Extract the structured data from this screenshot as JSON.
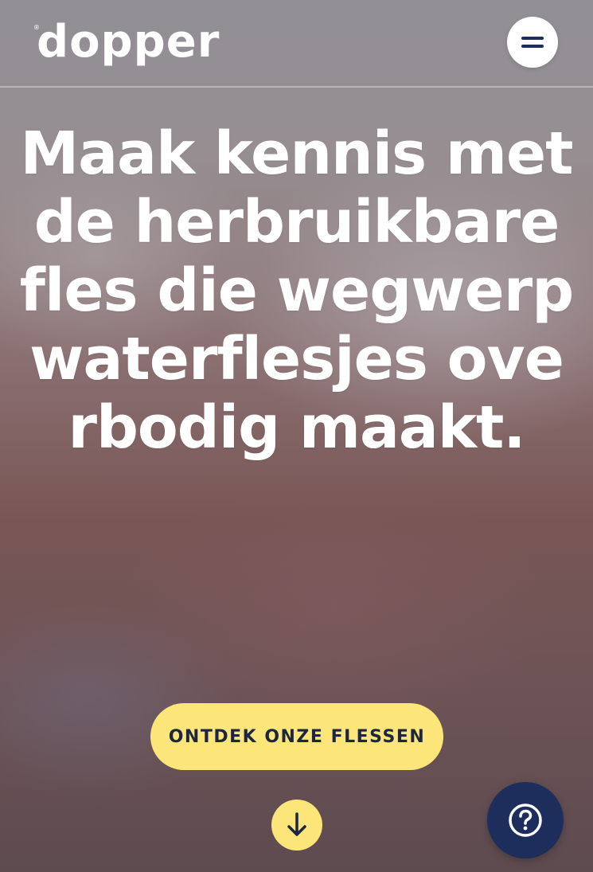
{
  "header": {
    "logo_text": "dopper",
    "logo_registered": "®",
    "menu_icon": "hamburger-menu-icon"
  },
  "hero": {
    "title": "Maak kennis met de herbruikbare fles die wegwerpwaterflesjes overbodig maakt.",
    "cta_label": "ONTDEK ONZE FLESSEN",
    "scroll_icon": "arrow-down-icon"
  },
  "help": {
    "icon": "question-mark-icon"
  },
  "colors": {
    "accent_yellow": "#fce67a",
    "navy": "#1d2e5c",
    "text_dark": "#1c2640",
    "white": "#ffffff"
  }
}
